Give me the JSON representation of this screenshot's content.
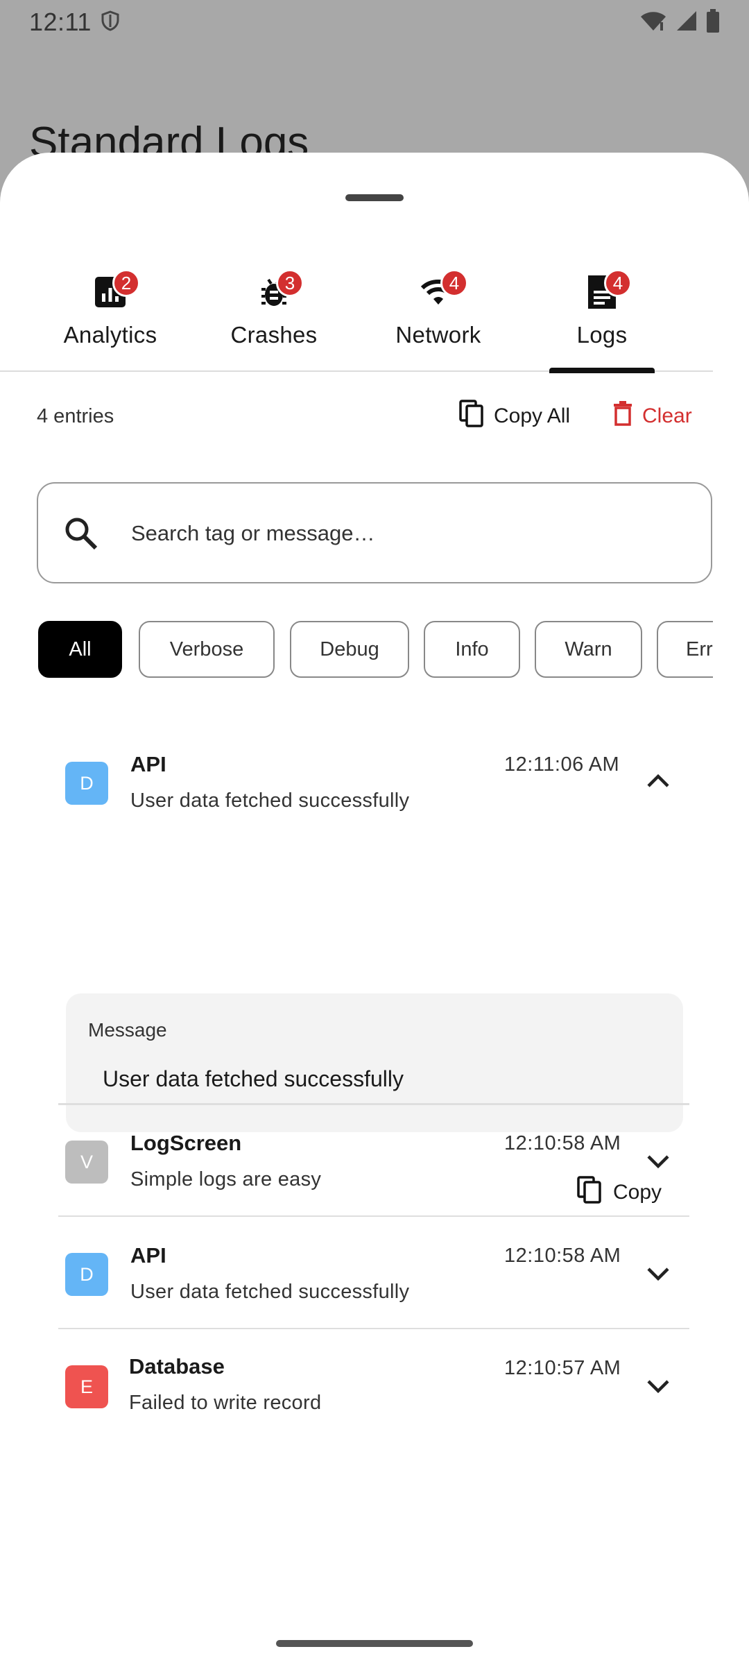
{
  "status_bar": {
    "time": "12:11"
  },
  "background": {
    "title": "Standard Logs"
  },
  "tabs": [
    {
      "label": "Analytics",
      "badge": "2",
      "icon": "bar-chart-icon",
      "active": false
    },
    {
      "label": "Crashes",
      "badge": "3",
      "icon": "bug-icon",
      "active": false
    },
    {
      "label": "Network",
      "badge": "4",
      "icon": "wifi-icon",
      "active": false
    },
    {
      "label": "Logs",
      "badge": "4",
      "icon": "document-icon",
      "active": true
    }
  ],
  "toolbar": {
    "entries": "4 entries",
    "copy_all": "Copy All",
    "clear": "Clear"
  },
  "search": {
    "placeholder": "Search tag or message…"
  },
  "filters": [
    {
      "label": "All",
      "selected": true
    },
    {
      "label": "Verbose",
      "selected": false
    },
    {
      "label": "Debug",
      "selected": false
    },
    {
      "label": "Info",
      "selected": false
    },
    {
      "label": "Warn",
      "selected": false
    },
    {
      "label": "Err",
      "selected": false
    }
  ],
  "logs": [
    {
      "level": "D",
      "tag": "API",
      "message": "User data fetched successfully",
      "time": "12:11:06 AM",
      "expanded": true,
      "color": "#64b5f6"
    },
    {
      "level": "V",
      "tag": "LogScreen",
      "message": "Simple logs are easy",
      "time": "12:10:58 AM",
      "expanded": false,
      "color": "#bdbdbd"
    },
    {
      "level": "D",
      "tag": "API",
      "message": "User data fetched successfully",
      "time": "12:10:58 AM",
      "expanded": false,
      "color": "#64b5f6"
    },
    {
      "level": "E",
      "tag": "Database",
      "message": "Failed to write record",
      "time": "12:10:57 AM",
      "expanded": false,
      "color": "#ef5350"
    }
  ],
  "detail": {
    "label": "Message",
    "message": "User data fetched successfully",
    "copy": "Copy"
  },
  "colors": {
    "accent_red": "#d32f2f",
    "selected_chip": "#000000"
  }
}
